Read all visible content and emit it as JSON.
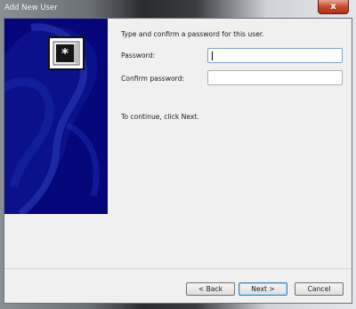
{
  "window": {
    "title": "Add New User",
    "close_label": "x"
  },
  "banner": {
    "logo_icon": "user-accounts-icon",
    "background": "#05067a"
  },
  "form": {
    "prompt": "Type and confirm a password for this user.",
    "password_label": "Password:",
    "password_value": "",
    "confirm_label": "Confirm password:",
    "confirm_value": "",
    "hint": "To continue, click Next."
  },
  "buttons": {
    "back": "< Back",
    "next": "Next >",
    "cancel": "Cancel"
  }
}
